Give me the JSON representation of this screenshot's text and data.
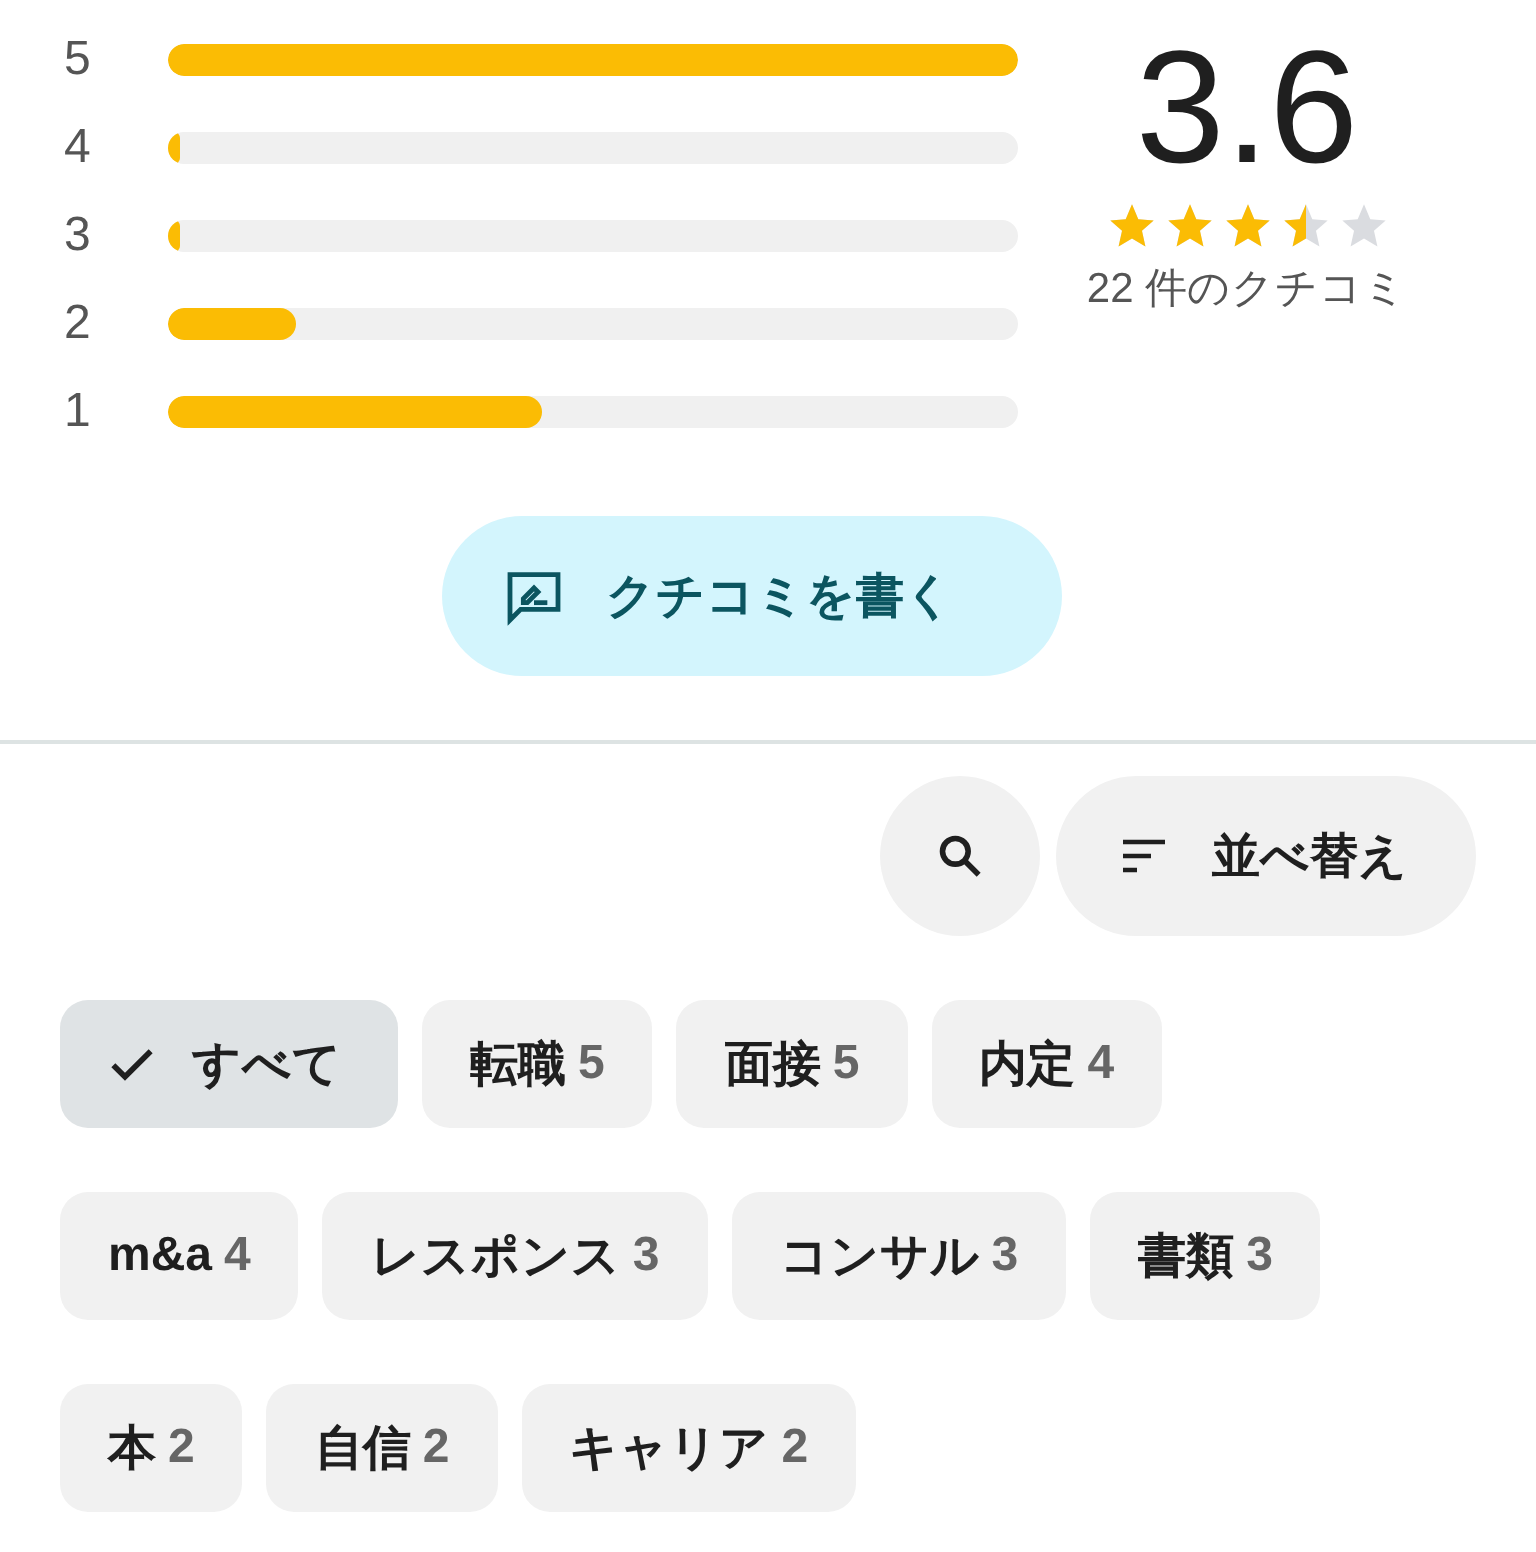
{
  "histogram": [
    {
      "label": "5",
      "level": 1.0
    },
    {
      "label": "4",
      "level": 0.015
    },
    {
      "label": "3",
      "level": 0.015
    },
    {
      "label": "2",
      "level": 0.15
    },
    {
      "label": "1",
      "level": 0.44
    }
  ],
  "summary": {
    "rating": "3.6",
    "stars": 3.5,
    "count": "22 件のクチコミ"
  },
  "write_button": {
    "label": "クチコミを書く"
  },
  "sort_button": {
    "label": "並べ替え"
  },
  "chip_rows": [
    {
      "chips": [
        {
          "label": "すべて",
          "selected": true
        },
        {
          "label": "転職",
          "count": "5",
          "selected": false
        },
        {
          "label": "面接",
          "count": "5",
          "selected": false
        },
        {
          "label": "内定",
          "count": "4",
          "selected": false
        }
      ]
    },
    {
      "chips": [
        {
          "label": "m&a",
          "count": "4",
          "selected": false
        },
        {
          "label": "レスポンス",
          "count": "3",
          "selected": false
        },
        {
          "label": "コンサル",
          "count": "3",
          "selected": false
        },
        {
          "label": "書類",
          "count": "3",
          "selected": false
        }
      ]
    },
    {
      "chips": [
        {
          "label": "本",
          "count": "2",
          "selected": false
        },
        {
          "label": "自信",
          "count": "2",
          "selected": false
        },
        {
          "label": "キャリア",
          "count": "2",
          "selected": false
        }
      ]
    }
  ]
}
